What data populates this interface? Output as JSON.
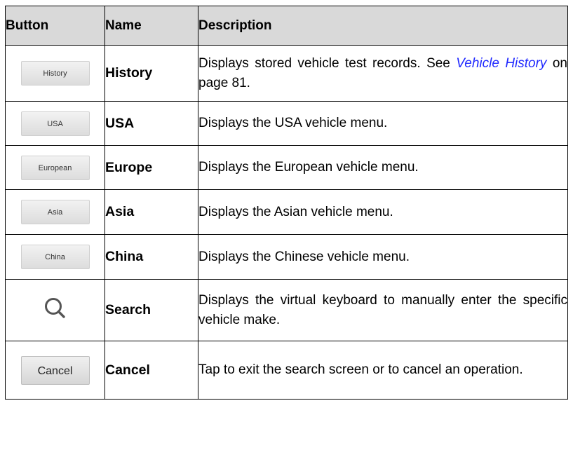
{
  "table": {
    "headers": [
      "Button",
      "Name",
      "Description"
    ],
    "rows": [
      {
        "button_label": "History",
        "name": "History",
        "desc_before": "Displays stored vehicle test records. See ",
        "link": "Vehicle History",
        "desc_after": " on page 81."
      },
      {
        "button_label": "USA",
        "name": "USA",
        "desc": "Displays the USA vehicle menu."
      },
      {
        "button_label": "European",
        "name": "Europe",
        "desc": "Displays the European vehicle menu."
      },
      {
        "button_label": "Asia",
        "name": "Asia",
        "desc": "Displays the Asian vehicle menu."
      },
      {
        "button_label": "China",
        "name": "China",
        "desc": "Displays the Chinese vehicle menu."
      },
      {
        "button_icon": "search-icon",
        "name": "Search",
        "desc": "Displays the virtual keyboard to manually enter the specific vehicle make."
      },
      {
        "button_label": "Cancel",
        "name": "Cancel",
        "desc": "Tap to exit the search screen or to cancel an operation."
      }
    ]
  },
  "colors": {
    "header_bg": "#d9d9d9",
    "link": "#1f28ff",
    "border": "#000000"
  }
}
